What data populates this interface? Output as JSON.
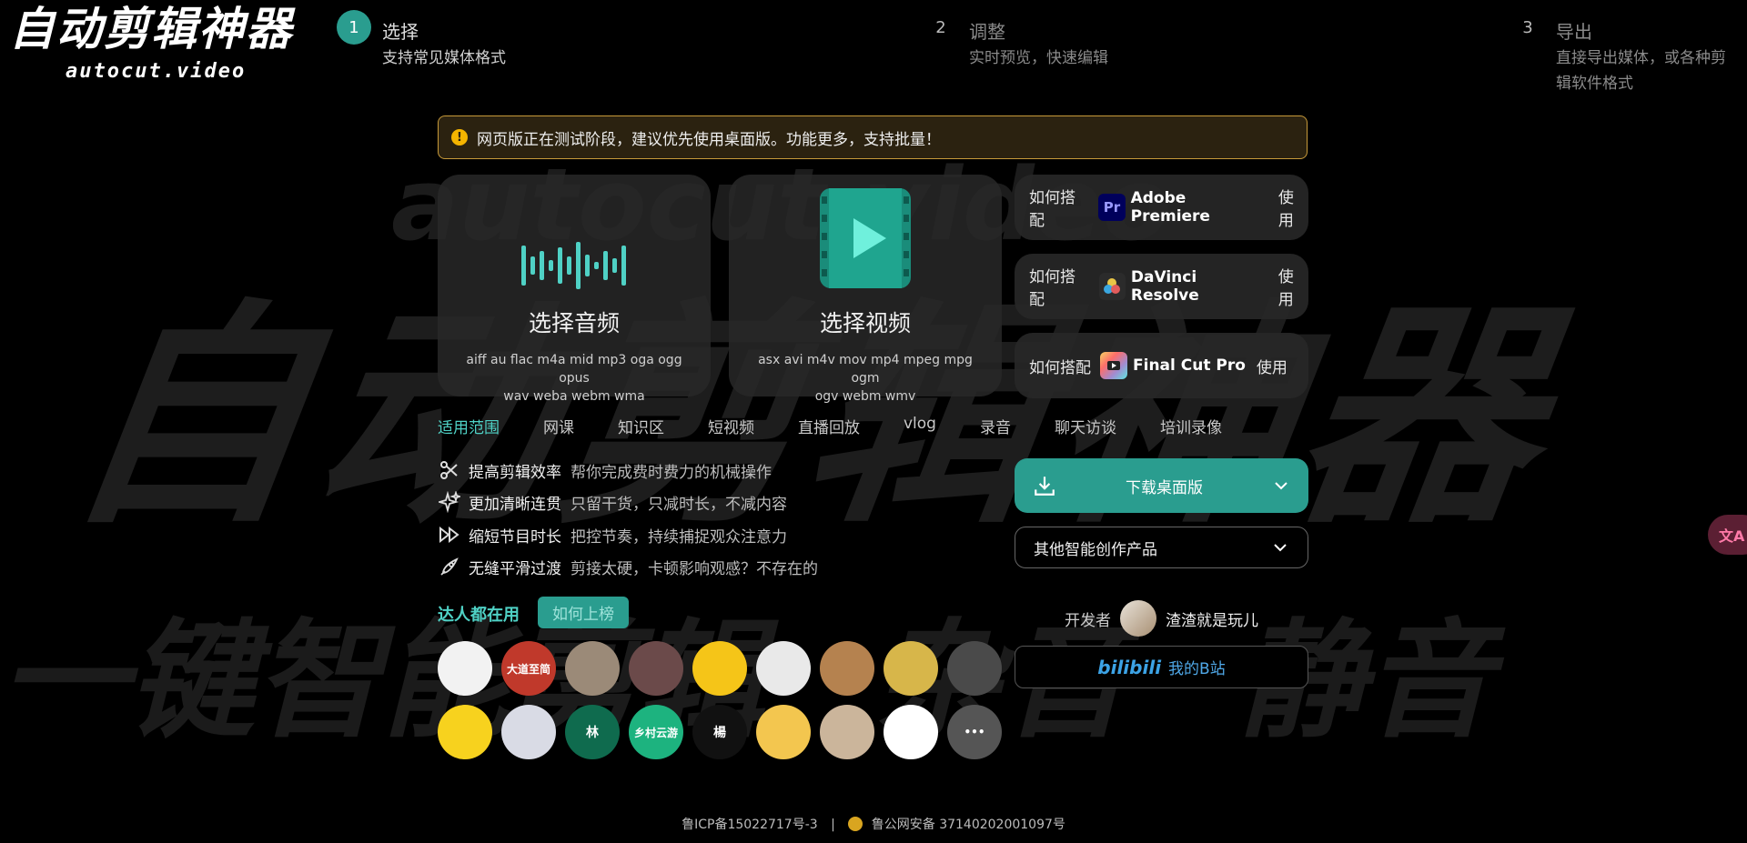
{
  "logo": {
    "cn": "自动剪辑神器",
    "en": "autocut.video"
  },
  "steps": [
    {
      "num": "1",
      "title": "选择",
      "desc": "支持常见媒体格式"
    },
    {
      "num": "2",
      "title": "调整",
      "desc": "实时预览，快速编辑"
    },
    {
      "num": "3",
      "title": "导出",
      "desc_line1": "直接导出媒体，或各种剪",
      "desc_line2": "辑软件格式"
    }
  ],
  "notice": {
    "icon": "!",
    "text": "网页版正在测试阶段，建议优先使用桌面版。功能更多，支持批量！"
  },
  "cards": {
    "audio": {
      "title": "选择音频",
      "formats_line1": "aiff au flac m4a mid mp3 oga ogg opus",
      "formats_line2": "wav weba webm wma"
    },
    "video": {
      "title": "选择视频",
      "formats_line1": "asx avi m4v mov mp4 mpeg mpg ogm",
      "formats_line2": "ogv webm wmv"
    }
  },
  "editors": [
    {
      "prefix": "如何搭配",
      "icon": "Pr",
      "name": "Adobe Premiere",
      "suffix": "使用"
    },
    {
      "prefix": "如何搭配",
      "icon": "",
      "name": "DaVinci Resolve",
      "suffix": "使用"
    },
    {
      "prefix": "如何搭配",
      "icon": "",
      "name": "Final Cut Pro",
      "suffix": "使用"
    }
  ],
  "scope_tabs": [
    "适用范围",
    "网课",
    "知识区",
    "短视频",
    "直播回放",
    "vlog",
    "录音",
    "聊天访谈",
    "培训录像"
  ],
  "features": [
    {
      "icon": "scissors-icon",
      "name": "提高剪辑效率",
      "desc": "帮你完成费时费力的机械操作"
    },
    {
      "icon": "sparkle-icon",
      "name": "更加清晰连贯",
      "desc": "只留干货，只减时长，不减内容"
    },
    {
      "icon": "fast-forward-icon",
      "name": "缩短节目时长",
      "desc": "把控节奏，持续捕捉观众注意力"
    },
    {
      "icon": "rocket-icon",
      "name": "无缝平滑过渡",
      "desc": "剪接太硬，卡顿影响观感？不存在的"
    }
  ],
  "experts": {
    "label": "达人都在用",
    "rank_button": "如何上榜",
    "avatars": [
      {
        "text": "",
        "bg": "#f2f2f2"
      },
      {
        "text": "大道至简",
        "bg": "#c0392b"
      },
      {
        "text": "",
        "bg": "#9b8a78"
      },
      {
        "text": "",
        "bg": "#6b4a4a"
      },
      {
        "text": "",
        "bg": "#f5c518"
      },
      {
        "text": "",
        "bg": "#e9e9e9"
      },
      {
        "text": "",
        "bg": "#b5824f"
      },
      {
        "text": "",
        "bg": "#d7b64a"
      },
      {
        "text": "",
        "bg": "#4a4a4a"
      },
      {
        "text": "",
        "bg": "#f7d21e"
      },
      {
        "text": "",
        "bg": "#d9dbe5"
      },
      {
        "text": "林",
        "bg": "#0f6b4e"
      },
      {
        "text": "乡村云游",
        "bg": "#1db37f"
      },
      {
        "text": "楊",
        "bg": "#111111"
      },
      {
        "text": "",
        "bg": "#f3c64f"
      },
      {
        "text": "",
        "bg": "#cbb59b"
      },
      {
        "text": "",
        "bg": "#ffffff"
      },
      {
        "text": "•••",
        "bg": "#555555"
      }
    ]
  },
  "download": {
    "label": "下载桌面版"
  },
  "other_products": {
    "label": "其他智能创作产品"
  },
  "developer": {
    "label": "开发者",
    "name": "渣渣就是玩儿"
  },
  "bilibili": {
    "logo": "bilibili",
    "label": "我的B站"
  },
  "footer": {
    "icp": "鲁ICP备15022717号-3",
    "separator": "|",
    "police": "鲁公网安备 37140202001097号"
  },
  "translate": {
    "label": "文A"
  },
  "background": {
    "big": "自动剪辑神器",
    "bottom_1": "一键智能剪辑",
    "bottom_2": "杂音",
    "bottom_3": "静音",
    "top": "autocut.video"
  },
  "colors": {
    "accent": "#2a9d8f",
    "accent_text": "#4fd1c5",
    "notice_border": "#c79a3a"
  }
}
